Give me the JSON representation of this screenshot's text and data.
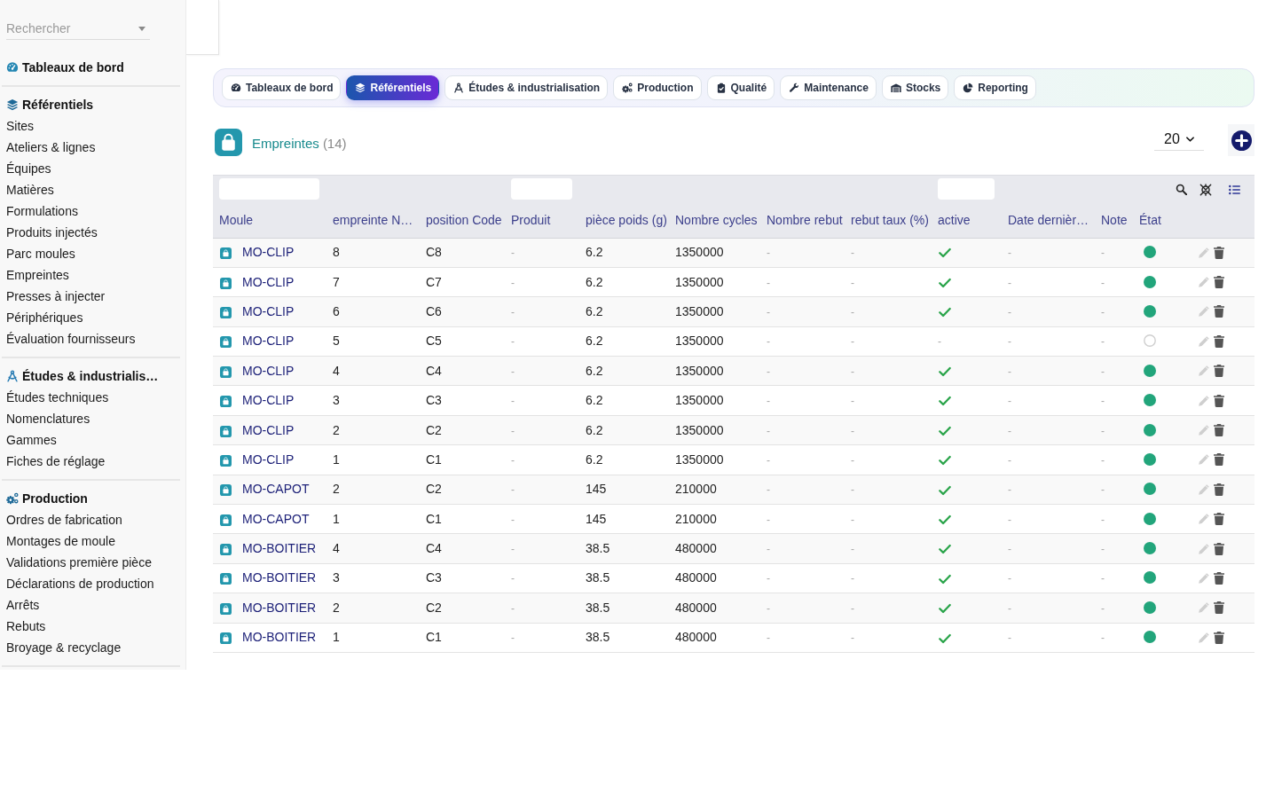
{
  "sidebar": {
    "search": {
      "placeholder": "Rechercher"
    },
    "sections": [
      {
        "title": "Tableaux de bord"
      },
      {
        "title": "Référentiels",
        "items": [
          "Sites",
          "Ateliers & lignes",
          "Équipes",
          "Matières",
          "Formulations",
          "Produits injectés",
          "Parc moules",
          "Empreintes",
          "Presses à injecter",
          "Périphériques",
          "Évaluation fournisseurs"
        ]
      },
      {
        "title": "Études & industrialis…",
        "items": [
          "Études techniques",
          "Nomenclatures",
          "Gammes",
          "Fiches de réglage"
        ]
      },
      {
        "title": "Production",
        "items": [
          "Ordres de fabrication",
          "Montages de moule",
          "Validations première pièce",
          "Déclarations de production",
          "Arrêts",
          "Rebuts",
          "Broyage & recyclage"
        ]
      }
    ]
  },
  "tabs": [
    {
      "label": "Tableaux de bord",
      "selected": false
    },
    {
      "label": "Référentiels",
      "selected": true
    },
    {
      "label": "Études & industrialisation",
      "selected": false
    },
    {
      "label": "Production",
      "selected": false
    },
    {
      "label": "Qualité",
      "selected": false
    },
    {
      "label": "Maintenance",
      "selected": false
    },
    {
      "label": "Stocks",
      "selected": false
    },
    {
      "label": "Reporting",
      "selected": false
    }
  ],
  "panel": {
    "title": "Empreintes",
    "count": "(14)",
    "page_size": "20"
  },
  "table": {
    "columns": [
      {
        "label": "Moule",
        "filter": true
      },
      {
        "label": "empreinte N…",
        "filter": false
      },
      {
        "label": "position Code",
        "filter": false
      },
      {
        "label": "Produit",
        "filter": true
      },
      {
        "label": "pièce poids (g)",
        "filter": false
      },
      {
        "label": "Nombre cycles",
        "filter": false
      },
      {
        "label": "Nombre rebut",
        "filter": false
      },
      {
        "label": "rebut taux (%)",
        "filter": false
      },
      {
        "label": "active",
        "filter": true
      },
      {
        "label": "Date dernièr…",
        "filter": false
      },
      {
        "label": "Note",
        "filter": false
      },
      {
        "label": "État",
        "filter": false
      }
    ],
    "rows": [
      {
        "moule": "MO-CLIP",
        "empreinte": "8",
        "position": "C8",
        "produit": "-",
        "poids": "6.2",
        "cycles": "1350000",
        "rebut": "-",
        "taux": "-",
        "active": true,
        "date": "-",
        "note": "-",
        "etat_on": true
      },
      {
        "moule": "MO-CLIP",
        "empreinte": "7",
        "position": "C7",
        "produit": "-",
        "poids": "6.2",
        "cycles": "1350000",
        "rebut": "-",
        "taux": "-",
        "active": true,
        "date": "-",
        "note": "-",
        "etat_on": true
      },
      {
        "moule": "MO-CLIP",
        "empreinte": "6",
        "position": "C6",
        "produit": "-",
        "poids": "6.2",
        "cycles": "1350000",
        "rebut": "-",
        "taux": "-",
        "active": true,
        "date": "-",
        "note": "-",
        "etat_on": true
      },
      {
        "moule": "MO-CLIP",
        "empreinte": "5",
        "position": "C5",
        "produit": "-",
        "poids": "6.2",
        "cycles": "1350000",
        "rebut": "-",
        "taux": "-",
        "active": false,
        "active_text": "-",
        "date": "-",
        "note": "-",
        "etat_on": false
      },
      {
        "moule": "MO-CLIP",
        "empreinte": "4",
        "position": "C4",
        "produit": "-",
        "poids": "6.2",
        "cycles": "1350000",
        "rebut": "-",
        "taux": "-",
        "active": true,
        "date": "-",
        "note": "-",
        "etat_on": true
      },
      {
        "moule": "MO-CLIP",
        "empreinte": "3",
        "position": "C3",
        "produit": "-",
        "poids": "6.2",
        "cycles": "1350000",
        "rebut": "-",
        "taux": "-",
        "active": true,
        "date": "-",
        "note": "-",
        "etat_on": true
      },
      {
        "moule": "MO-CLIP",
        "empreinte": "2",
        "position": "C2",
        "produit": "-",
        "poids": "6.2",
        "cycles": "1350000",
        "rebut": "-",
        "taux": "-",
        "active": true,
        "date": "-",
        "note": "-",
        "etat_on": true
      },
      {
        "moule": "MO-CLIP",
        "empreinte": "1",
        "position": "C1",
        "produit": "-",
        "poids": "6.2",
        "cycles": "1350000",
        "rebut": "-",
        "taux": "-",
        "active": true,
        "date": "-",
        "note": "-",
        "etat_on": true
      },
      {
        "moule": "MO-CAPOT",
        "empreinte": "2",
        "position": "C2",
        "produit": "-",
        "poids": "145",
        "cycles": "210000",
        "rebut": "-",
        "taux": "-",
        "active": true,
        "date": "-",
        "note": "-",
        "etat_on": true
      },
      {
        "moule": "MO-CAPOT",
        "empreinte": "1",
        "position": "C1",
        "produit": "-",
        "poids": "145",
        "cycles": "210000",
        "rebut": "-",
        "taux": "-",
        "active": true,
        "date": "-",
        "note": "-",
        "etat_on": true
      },
      {
        "moule": "MO-BOITIER",
        "empreinte": "4",
        "position": "C4",
        "produit": "-",
        "poids": "38.5",
        "cycles": "480000",
        "rebut": "-",
        "taux": "-",
        "active": true,
        "date": "-",
        "note": "-",
        "etat_on": true
      },
      {
        "moule": "MO-BOITIER",
        "empreinte": "3",
        "position": "C3",
        "produit": "-",
        "poids": "38.5",
        "cycles": "480000",
        "rebut": "-",
        "taux": "-",
        "active": true,
        "date": "-",
        "note": "-",
        "etat_on": true
      },
      {
        "moule": "MO-BOITIER",
        "empreinte": "2",
        "position": "C2",
        "produit": "-",
        "poids": "38.5",
        "cycles": "480000",
        "rebut": "-",
        "taux": "-",
        "active": true,
        "date": "-",
        "note": "-",
        "etat_on": true
      },
      {
        "moule": "MO-BOITIER",
        "empreinte": "1",
        "position": "C1",
        "produit": "-",
        "poids": "38.5",
        "cycles": "480000",
        "rebut": "-",
        "taux": "-",
        "active": true,
        "date": "-",
        "note": "-",
        "etat_on": true
      }
    ]
  }
}
